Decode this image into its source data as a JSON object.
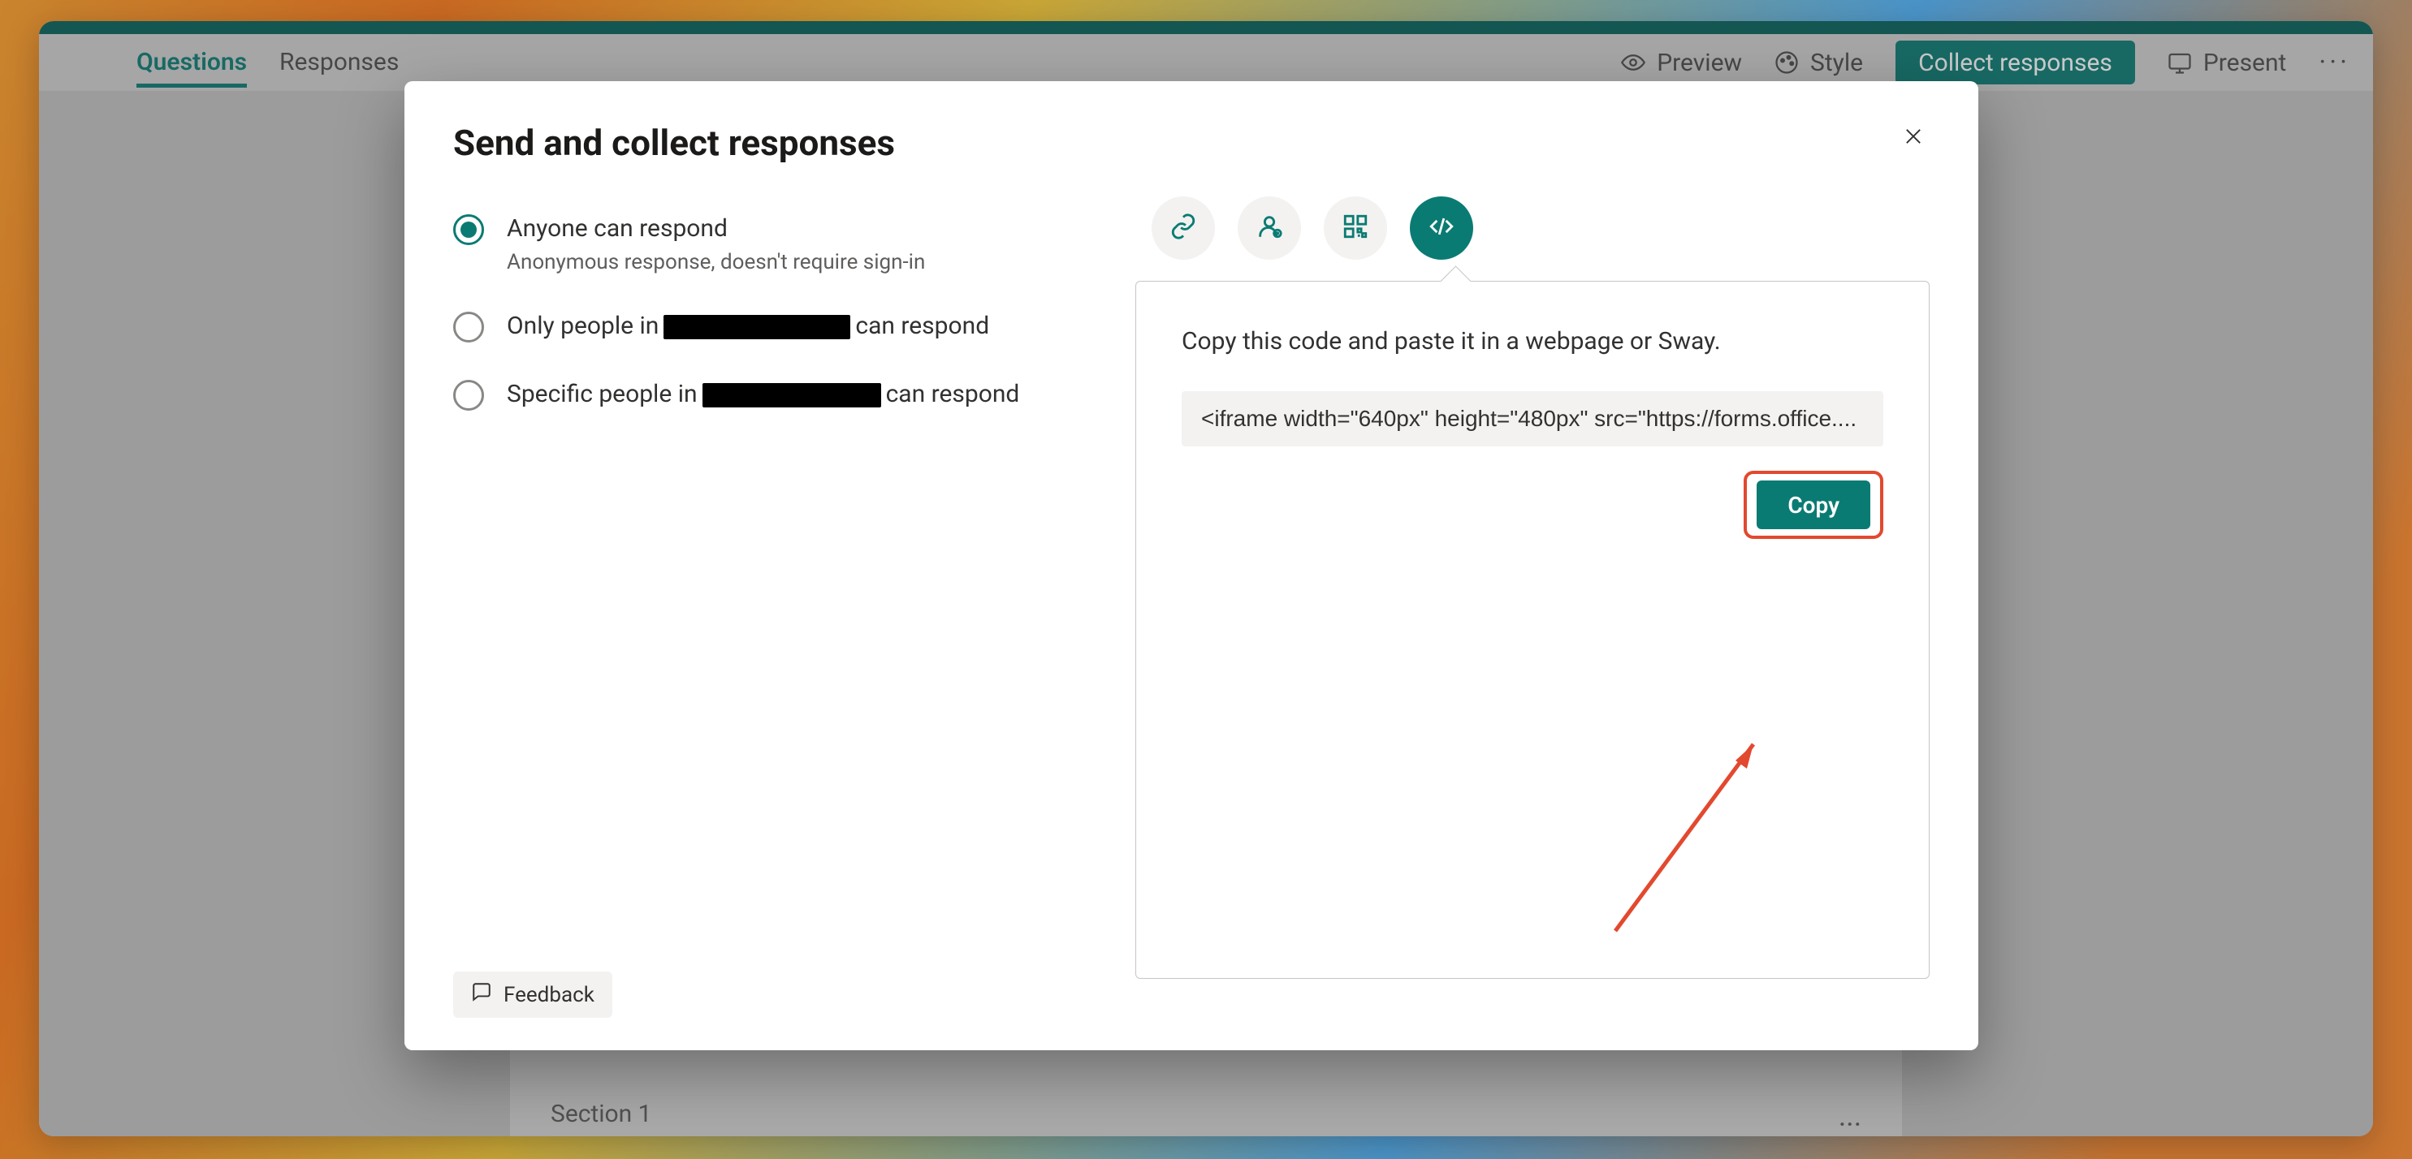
{
  "header": {
    "tabs": {
      "questions": "Questions",
      "responses": "Responses"
    },
    "preview": "Preview",
    "style": "Style",
    "collect": "Collect responses",
    "present": "Present"
  },
  "background_section": {
    "title": "Section 1"
  },
  "dialog": {
    "title": "Send and collect responses",
    "options": {
      "anyone": {
        "label": "Anyone can respond",
        "sub": "Anonymous response, doesn't require sign-in"
      },
      "org_prefix": "Only people in",
      "org_suffix": "can respond",
      "specific_prefix": "Specific people in",
      "specific_suffix": "can respond"
    },
    "feedback": "Feedback",
    "share_tabs": {
      "link": "link-icon",
      "invite": "invite-icon",
      "qr": "qr-icon",
      "embed": "embed-icon"
    },
    "panel": {
      "instruction": "Copy this code and paste it in a webpage or Sway.",
      "code": "<iframe width=\"640px\" height=\"480px\" src=\"https://forms.office....",
      "copy": "Copy"
    }
  }
}
